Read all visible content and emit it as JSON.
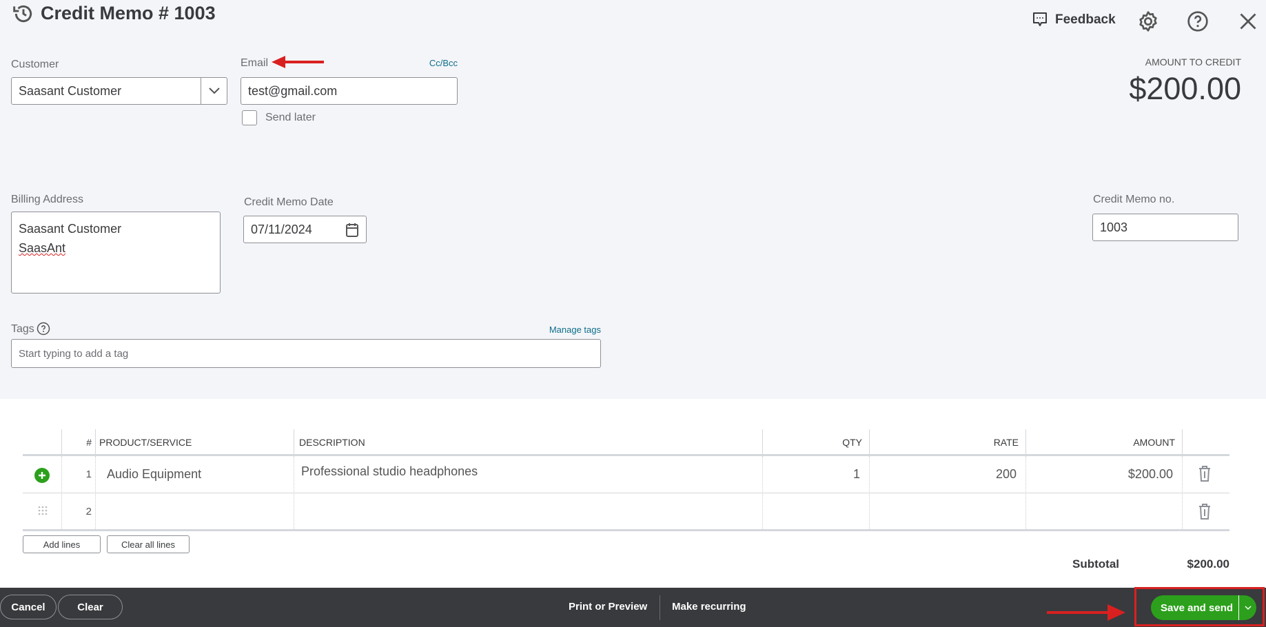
{
  "header": {
    "title": "Credit Memo # 1003",
    "feedback_label": "Feedback",
    "icons": [
      "history-icon",
      "feedback-icon",
      "gear-icon",
      "help-icon",
      "close-icon"
    ]
  },
  "customer": {
    "label": "Customer",
    "value": "Saasant Customer"
  },
  "email": {
    "label": "Email",
    "value": "test@gmail.com",
    "cc_bcc": "Cc/Bcc",
    "send_later": "Send later",
    "send_later_checked": false
  },
  "amount": {
    "label": "AMOUNT TO CREDIT",
    "value": "$200.00"
  },
  "billing": {
    "label": "Billing Address",
    "line1": "Saasant Customer",
    "line2": "SaasAnt"
  },
  "date": {
    "label": "Credit Memo Date",
    "value": "07/11/2024"
  },
  "memo_no": {
    "label": "Credit Memo no.",
    "value": "1003"
  },
  "tags": {
    "label": "Tags",
    "manage": "Manage tags",
    "placeholder": "Start typing to add a tag"
  },
  "table": {
    "headers": [
      "#",
      "PRODUCT/SERVICE",
      "DESCRIPTION",
      "QTY",
      "RATE",
      "AMOUNT"
    ],
    "rows": [
      {
        "num": "1",
        "product": "Audio Equipment",
        "description": "Professional studio headphones",
        "qty": "1",
        "rate": "200",
        "amount": "$200.00"
      },
      {
        "num": "2",
        "product": "",
        "description": "",
        "qty": "",
        "rate": "",
        "amount": ""
      }
    ],
    "add_lines": "Add lines",
    "clear_all": "Clear all lines",
    "subtotal_label": "Subtotal",
    "subtotal_value": "$200.00"
  },
  "footer": {
    "cancel": "Cancel",
    "clear": "Clear",
    "print": "Print or Preview",
    "recurring": "Make recurring",
    "save_send": "Save and send"
  },
  "colors": {
    "primary_green": "#2ca01c",
    "footer_bg": "#393a3d",
    "annotation_red": "#d92020",
    "link": "#0d6e8a"
  }
}
